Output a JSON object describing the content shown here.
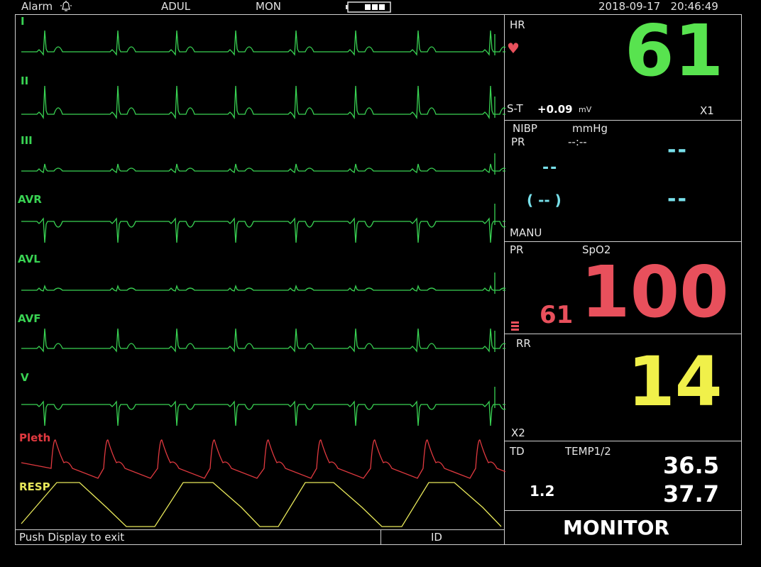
{
  "header": {
    "alarm_label": "Alarm",
    "patient_type": "ADUL",
    "mode": "MON",
    "datetime": "2018-09-17   20:46:49"
  },
  "leads": [
    "I",
    "II",
    "III",
    "AVR",
    "AVL",
    "AVF",
    "V"
  ],
  "waveforms": {
    "pleth_label": "Pleth",
    "resp_label": "RESP"
  },
  "hr": {
    "label": "HR",
    "value": "61",
    "st_label": "S-T",
    "st_value": "+0.09",
    "st_unit": "mV",
    "gain": "X1"
  },
  "nibp": {
    "label": "NIBP",
    "unit": "mmHg",
    "pr_label": "PR",
    "time": "--:--",
    "pr_value": "--",
    "sys": "--",
    "dia": "--",
    "mean": "( -- )",
    "mode": "MANU"
  },
  "spo2": {
    "pr_label": "PR",
    "label": "SpO2",
    "pr_value": "61",
    "value": "100"
  },
  "rr": {
    "label": "RR",
    "value": "14",
    "gain": "X2"
  },
  "temp": {
    "td_label": "TD",
    "label": "TEMP1/2",
    "td_value": "1.2",
    "t1": "36.5",
    "t2": "37.7"
  },
  "footer": {
    "message": "Push Display to exit",
    "id_label": "ID",
    "mode_label": "MONITOR"
  },
  "colors": {
    "ecg": "#39d353",
    "pleth": "#e0393f",
    "resp": "#e8e85a",
    "hr": "#58e34f",
    "nibp": "#78e0ea",
    "spo2": "#e8505c",
    "rr": "#f0f04a",
    "temp": "#ffffff"
  }
}
